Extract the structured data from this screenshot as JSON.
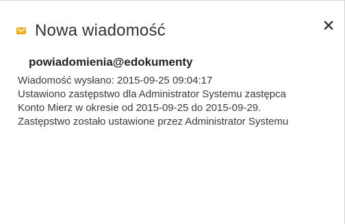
{
  "notification": {
    "title": "Nowa wiadomość",
    "icon": "envelope-icon",
    "icon_color": "#f2b321",
    "close_icon": "close-icon",
    "sender": "powiadomienia@edokumenty",
    "lines": [
      "Wiadomość wysłano: 2015-09-25 09:04:17",
      "Ustawiono zastępstwo dla Administrator Systemu zastępca",
      "Konto Mierz w okresie od 2015-09-25 do 2015-09-29.",
      "Zastępstwo zostało ustawione przez Administrator Systemu"
    ]
  }
}
